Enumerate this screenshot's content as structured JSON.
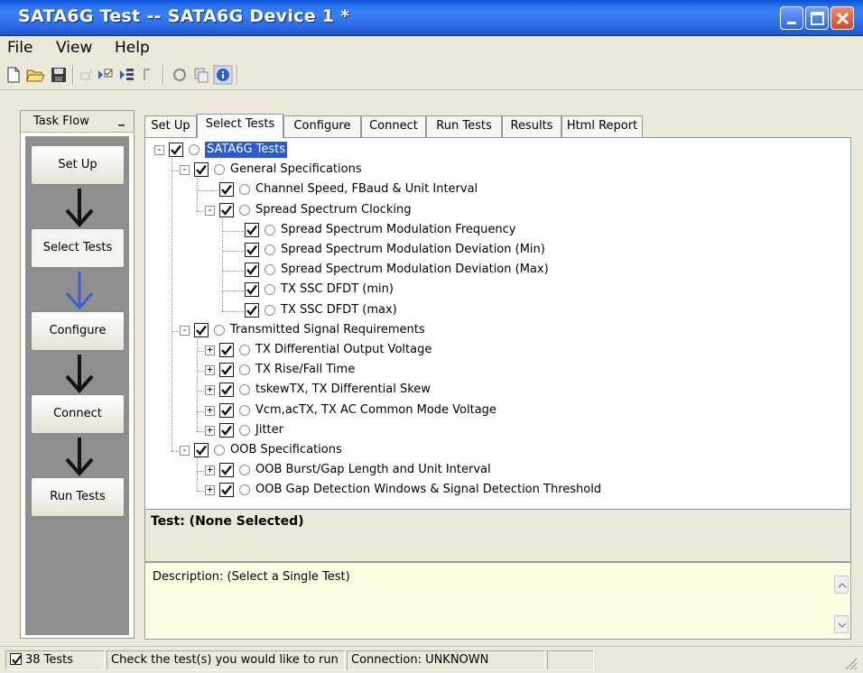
{
  "window": {
    "title": "SATA6G Test -- SATA6G Device 1 *"
  },
  "menu": {
    "items": [
      "File",
      "View",
      "Help"
    ]
  },
  "toolbar": {
    "icons": [
      "new-icon",
      "open-icon",
      "save-icon",
      "undo-icon",
      "run-check-icon",
      "run-list-icon",
      "stop-icon",
      "refresh-icon",
      "copy-icon",
      "info-icon"
    ]
  },
  "taskflow": {
    "header": "Task Flow",
    "steps": [
      "Set Up",
      "Select Tests",
      "Configure",
      "Connect",
      "Run Tests"
    ],
    "active": "Select Tests"
  },
  "tabs": [
    "Set Up",
    "Select Tests",
    "Configure",
    "Connect",
    "Run Tests",
    "Results",
    "Html Report"
  ],
  "active_tab": "Select Tests",
  "tree": [
    {
      "label": "SATA6G Tests",
      "checked": true,
      "selected": true
    },
    {
      "label": "General Specifications",
      "checked": true
    },
    {
      "label": "Channel Speed, FBaud & Unit Interval",
      "checked": true
    },
    {
      "label": "Spread Spectrum Clocking",
      "checked": true
    },
    {
      "label": "Spread Spectrum Modulation Frequency",
      "checked": true
    },
    {
      "label": "Spread Spectrum Modulation Deviation (Min)",
      "checked": true
    },
    {
      "label": "Spread Spectrum Modulation Deviation (Max)",
      "checked": true
    },
    {
      "label": "TX SSC DFDT (min)",
      "checked": true
    },
    {
      "label": "TX SSC DFDT (max)",
      "checked": true
    },
    {
      "label": "Transmitted Signal Requirements",
      "checked": true
    },
    {
      "label": "TX Differential Output Voltage",
      "checked": true
    },
    {
      "label": "TX Rise/Fall Time",
      "checked": true
    },
    {
      "label": "tskewTX, TX Differential Skew",
      "checked": true
    },
    {
      "label": "Vcm,acTX, TX AC Common Mode Voltage",
      "checked": true
    },
    {
      "label": "Jitter",
      "checked": true
    },
    {
      "label": "OOB Specifications",
      "checked": true
    },
    {
      "label": "OOB Burst/Gap Length and Unit Interval",
      "checked": true
    },
    {
      "label": "OOB Gap Detection Windows & Signal Detection Threshold",
      "checked": true
    }
  ],
  "test_info": {
    "label": "Test: (None Selected)"
  },
  "description": {
    "label": "Description: (Select a Single Test)"
  },
  "status": {
    "tests": "38 Tests",
    "hint": "Check the test(s) you would like to run",
    "connection": "Connection: UNKNOWN"
  }
}
